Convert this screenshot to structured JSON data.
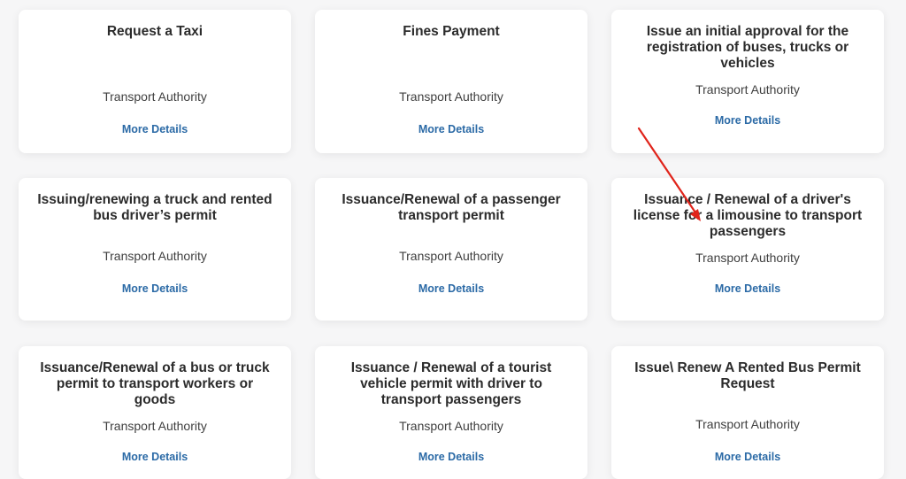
{
  "cards": [
    {
      "title": "Request a Taxi",
      "authority": "Transport Authority",
      "link": "More Details"
    },
    {
      "title": "Fines Payment",
      "authority": "Transport Authority",
      "link": "More Details"
    },
    {
      "title": "Issue an initial approval for the registration of buses, trucks or vehicles",
      "authority": "Transport Authority",
      "link": "More Details"
    },
    {
      "title": "Issuing/renewing a truck and rented bus driver’s permit",
      "authority": "Transport Authority",
      "link": "More Details"
    },
    {
      "title": "Issuance/Renewal of a passenger transport permit",
      "authority": "Transport Authority",
      "link": "More Details"
    },
    {
      "title": "Issuance / Renewal of a driver's license for a limousine to transport passengers",
      "authority": "Transport Authority",
      "link": "More Details"
    },
    {
      "title": "Issuance/Renewal of a bus or truck permit to transport workers or goods",
      "authority": "Transport Authority",
      "link": "More Details"
    },
    {
      "title": "Issuance / Renewal of a tourist vehicle permit with driver to transport passengers",
      "authority": "Transport Authority",
      "link": "More Details"
    },
    {
      "title": "Issue\\ Renew A Rented Bus Permit Request",
      "authority": "Transport Authority",
      "link": "More Details"
    }
  ],
  "annotation": {
    "color": "#e0241b"
  }
}
